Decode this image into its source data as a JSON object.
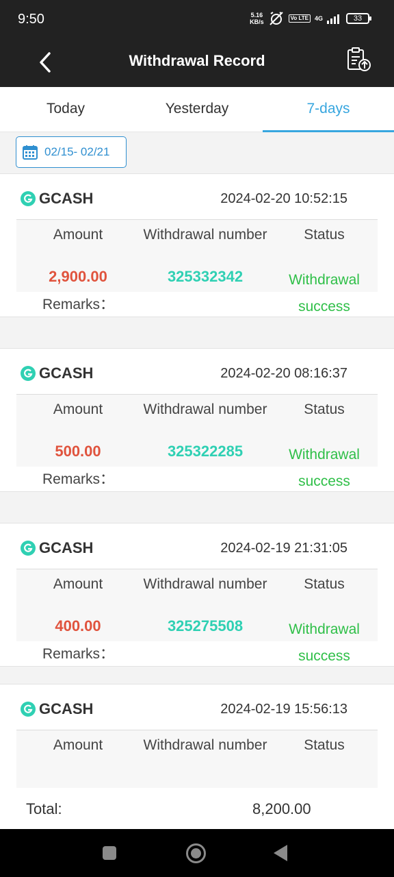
{
  "status_bar": {
    "time": "9:50",
    "speed_value": "5.16",
    "speed_unit": "KB/s",
    "volte": "Vo LTE",
    "network": "4G",
    "battery": "33"
  },
  "header": {
    "title": "Withdrawal Record"
  },
  "tabs": [
    {
      "label": "Today",
      "active": false
    },
    {
      "label": "Yesterday",
      "active": false
    },
    {
      "label": "7-days",
      "active": true
    }
  ],
  "date_range": "02/15- 02/21",
  "labels": {
    "amount": "Amount",
    "withdrawal_number": "Withdrawal number",
    "status": "Status",
    "remarks": "Remarks："
  },
  "records": [
    {
      "method": "GCASH",
      "datetime": "2024-02-20 10:52:15",
      "amount": "2,900.00",
      "number": "325332342",
      "status_line1": "Withdrawal",
      "status_line2": "success"
    },
    {
      "method": "GCASH",
      "datetime": "2024-02-20 08:16:37",
      "amount": "500.00",
      "number": "325322285",
      "status_line1": "Withdrawal",
      "status_line2": "success"
    },
    {
      "method": "GCASH",
      "datetime": "2024-02-19 21:31:05",
      "amount": "400.00",
      "number": "325275508",
      "status_line1": "Withdrawal",
      "status_line2": "success"
    },
    {
      "method": "GCASH",
      "datetime": "2024-02-19 15:56:13"
    }
  ],
  "total": {
    "label": "Total:",
    "value": "8,200.00"
  },
  "colors": {
    "accent": "#37a6df",
    "amount": "#e0533d",
    "number": "#2fd0b3",
    "success": "#2fbf48",
    "header_bg": "#222222"
  }
}
